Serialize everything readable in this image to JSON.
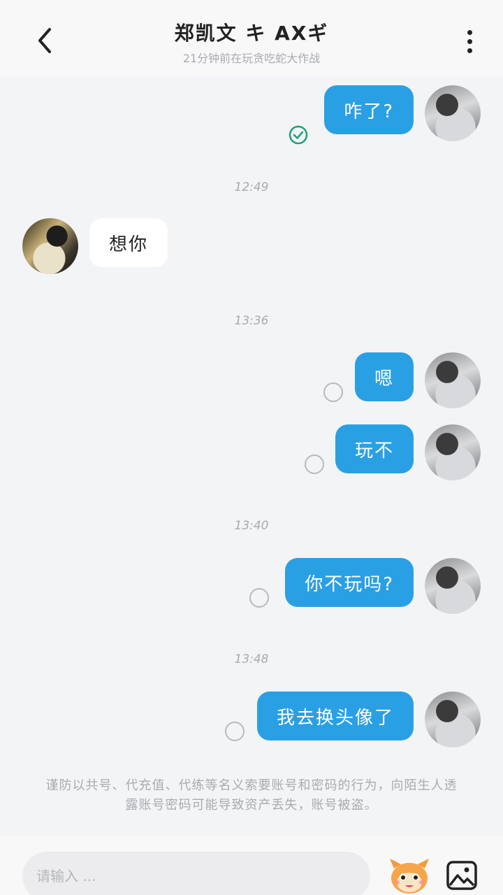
{
  "header": {
    "title": "郑凯文 キ AXギ",
    "subtitle": "21分钟前在玩贪吃蛇大作战",
    "back_icon": "chevron-left-icon",
    "more_icon": "more-vertical-icon"
  },
  "messages": [
    {
      "side": "me",
      "text": "咋了?",
      "status": "read"
    },
    {
      "time": "12:49"
    },
    {
      "side": "other",
      "text": "想你"
    },
    {
      "time": "13:36"
    },
    {
      "side": "me",
      "text": "嗯",
      "status": "pending"
    },
    {
      "side": "me",
      "text": "玩不",
      "status": "pending"
    },
    {
      "time": "13:40"
    },
    {
      "side": "me",
      "text": "你不玩吗?",
      "status": "pending"
    },
    {
      "time": "13:48"
    },
    {
      "side": "me",
      "text": "我去换头像了",
      "status": "pending"
    }
  ],
  "notice": "谨防以共号、代充值、代练等名义索要账号和密码的行为，向陌生人透露账号密码可能导致资产丢失，账号被盗。",
  "input": {
    "placeholder": "请输入 ...",
    "value": ""
  },
  "colors": {
    "my_bubble": "#2aa0e4",
    "other_bubble": "#ffffff",
    "read_check": "#1aa36f",
    "background": "#f3f4f6"
  }
}
